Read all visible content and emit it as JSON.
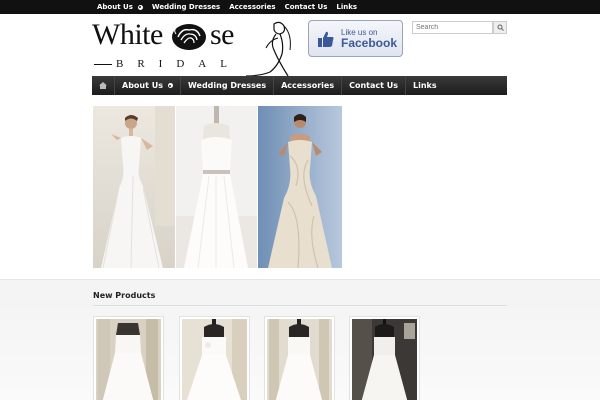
{
  "top_nav": {
    "items": [
      {
        "label": "About Us",
        "has_submenu": true
      },
      {
        "label": "Wedding Dresses",
        "has_submenu": false
      },
      {
        "label": "Accessories",
        "has_submenu": false
      },
      {
        "label": "Contact Us",
        "has_submenu": false
      },
      {
        "label": "Links",
        "has_submenu": false
      }
    ]
  },
  "logo": {
    "line1_a": "White",
    "line1_b": "se",
    "line2": "BRIDAL",
    "icons": [
      "rose-icon",
      "bride-silhouette-icon"
    ]
  },
  "facebook": {
    "line1": "Like us on",
    "line2": "Facebook",
    "icon": "thumbs-up-icon",
    "color": "#3b5998"
  },
  "search": {
    "placeholder": "Search",
    "icon": "search-icon"
  },
  "main_nav": {
    "home_icon": "home-icon",
    "items": [
      {
        "label": "About Us",
        "has_submenu": true
      },
      {
        "label": "Wedding Dresses",
        "has_submenu": false
      },
      {
        "label": "Accessories",
        "has_submenu": false
      },
      {
        "label": "Contact Us",
        "has_submenu": false
      },
      {
        "label": "Links",
        "has_submenu": false
      }
    ]
  },
  "hero_gallery": {
    "images": [
      "bride-lace-gown-photo",
      "strapless-gown-mannequin-photo",
      "draped-satin-gown-photo"
    ]
  },
  "new_products": {
    "title": "New Products",
    "items": [
      "gown-product-1",
      "gown-product-2",
      "gown-product-3",
      "gown-product-4"
    ]
  }
}
